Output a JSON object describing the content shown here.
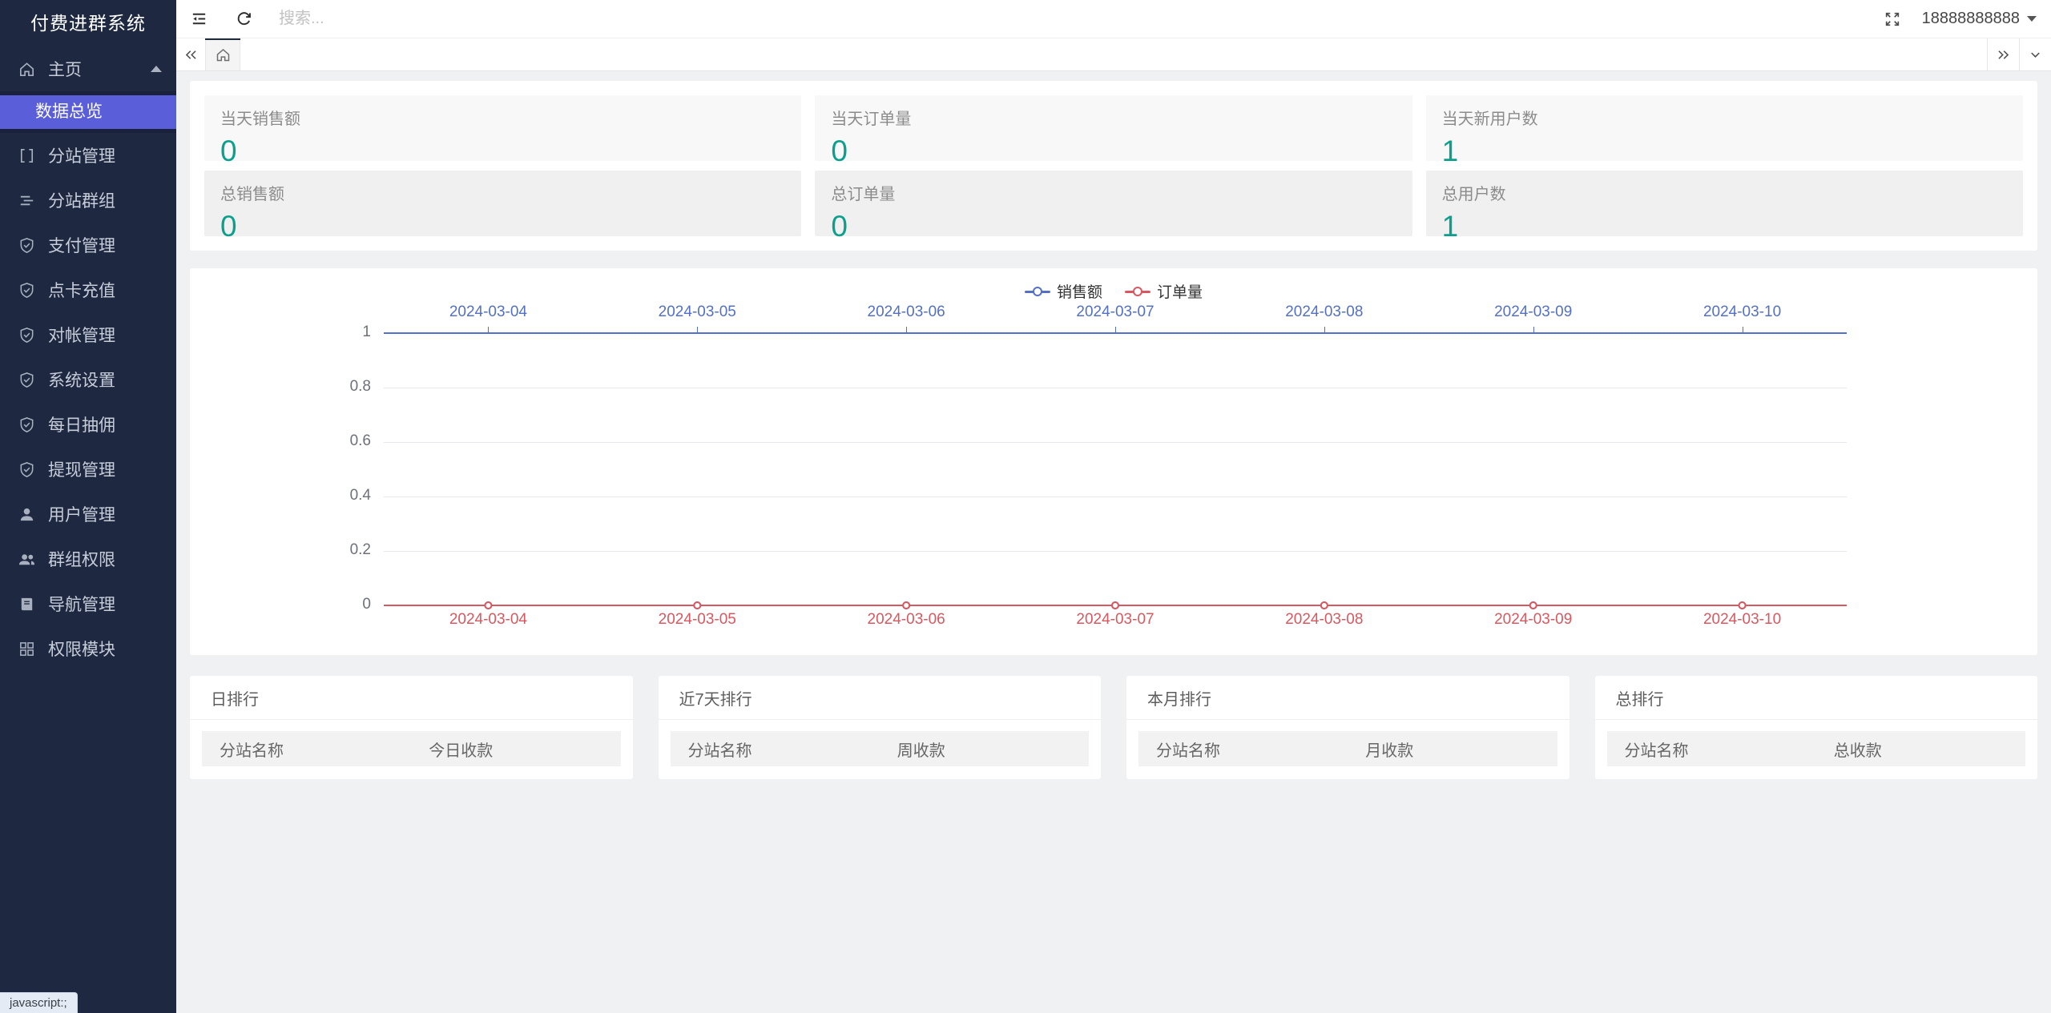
{
  "app": {
    "title": "付费进群系统"
  },
  "sidebar": {
    "items": [
      {
        "label": "主页",
        "icon": "home-icon",
        "expanded": true,
        "children": [
          {
            "label": "数据总览",
            "active": true
          }
        ]
      },
      {
        "label": "分站管理",
        "icon": "component-icon"
      },
      {
        "label": "分站群组",
        "icon": "list-icon"
      },
      {
        "label": "支付管理",
        "icon": "shield-check-icon"
      },
      {
        "label": "点卡充值",
        "icon": "shield-check-icon"
      },
      {
        "label": "对帐管理",
        "icon": "shield-check-icon"
      },
      {
        "label": "系统设置",
        "icon": "shield-check-icon"
      },
      {
        "label": "每日抽佣",
        "icon": "shield-check-icon"
      },
      {
        "label": "提现管理",
        "icon": "shield-check-icon"
      },
      {
        "label": "用户管理",
        "icon": "user-icon"
      },
      {
        "label": "群组权限",
        "icon": "users-icon"
      },
      {
        "label": "导航管理",
        "icon": "book-icon"
      },
      {
        "label": "权限模块",
        "icon": "modules-icon"
      }
    ]
  },
  "topbar": {
    "search_placeholder": "搜索...",
    "user": "18888888888"
  },
  "stats": {
    "cards": [
      {
        "label": "当天销售额",
        "value": "0"
      },
      {
        "label": "当天订单量",
        "value": "0"
      },
      {
        "label": "当天新用户数",
        "value": "1"
      },
      {
        "label": "总销售额",
        "value": "0"
      },
      {
        "label": "总订单量",
        "value": "0"
      },
      {
        "label": "总用户数",
        "value": "1"
      }
    ]
  },
  "chart_data": {
    "type": "line",
    "title": "",
    "categories": [
      "2024-03-04",
      "2024-03-05",
      "2024-03-06",
      "2024-03-07",
      "2024-03-08",
      "2024-03-09",
      "2024-03-10"
    ],
    "series": [
      {
        "name": "销售额",
        "axis": "top",
        "color": "#5470c6",
        "values": [
          0,
          0,
          0,
          0,
          0,
          0,
          0
        ]
      },
      {
        "name": "订单量",
        "axis": "bottom",
        "color": "#d9585f",
        "values": [
          0,
          0,
          0,
          0,
          0,
          0,
          0
        ]
      }
    ],
    "xlabel": "",
    "ylabel": "",
    "ylim": [
      0,
      1
    ],
    "yticks": [
      0,
      0.2,
      0.4,
      0.6,
      0.8,
      1
    ],
    "grid": true,
    "legend_position": "top-center"
  },
  "rankings": {
    "panels": [
      {
        "title": "日排行",
        "columns": [
          "分站名称",
          "今日收款"
        ],
        "rows": []
      },
      {
        "title": "近7天排行",
        "columns": [
          "分站名称",
          "周收款"
        ],
        "rows": []
      },
      {
        "title": "本月排行",
        "columns": [
          "分站名称",
          "月收款"
        ],
        "rows": []
      },
      {
        "title": "总排行",
        "columns": [
          "分站名称",
          "总收款"
        ],
        "rows": []
      }
    ]
  },
  "statusbar": {
    "link_hint": "javascript:;"
  },
  "colors": {
    "sidebar_bg": "#1e2941",
    "submenu_bg": "#19223a",
    "active_item": "#5a5ed8",
    "stat_value": "#0d9f8d",
    "chart_blue": "#5470c6",
    "chart_red": "#d9585f",
    "tab_indicator": "#1f2a3c"
  }
}
